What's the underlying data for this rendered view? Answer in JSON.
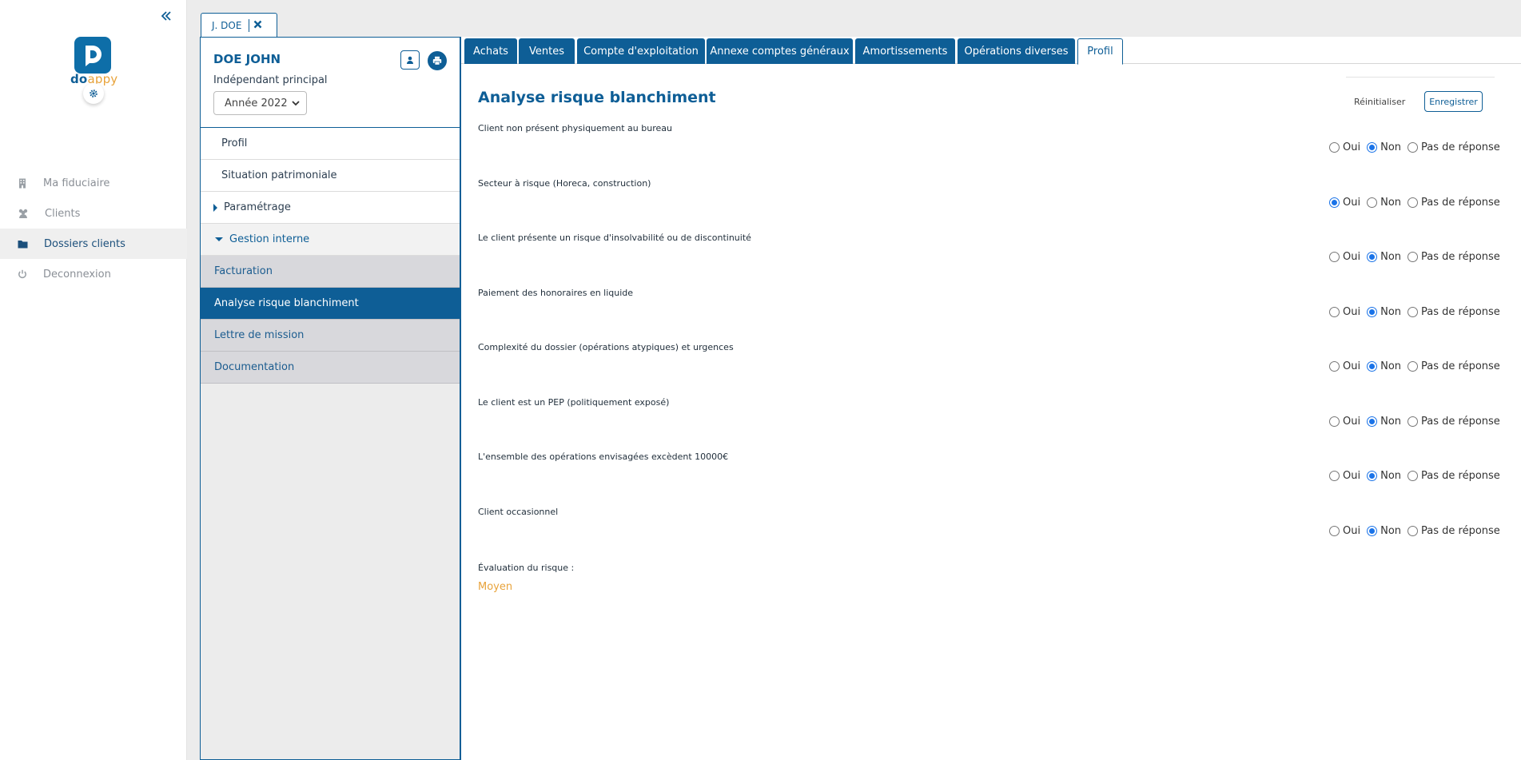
{
  "brand": {
    "name_part1": "do",
    "name_part2": "appy"
  },
  "nav": [
    {
      "label": "Ma fiduciaire",
      "icon": "building-icon",
      "active": false
    },
    {
      "label": "Clients",
      "icon": "users-icon",
      "active": false
    },
    {
      "label": "Dossiers clients",
      "icon": "folder-icon",
      "active": true
    },
    {
      "label": "Deconnexion",
      "icon": "power-icon",
      "active": false
    }
  ],
  "client_tab": {
    "label": "J. DOE"
  },
  "dossier": {
    "name": "DOE JOHN",
    "subtitle": "Indépendant principal",
    "year": "Année 2022"
  },
  "menu": {
    "profil": "Profil",
    "situation": "Situation patrimoniale",
    "parametrage": "Paramétrage",
    "gestion": "Gestion interne",
    "children": [
      "Facturation",
      "Analyse risque blanchiment",
      "Lettre de mission",
      "Documentation"
    ]
  },
  "tabs": [
    "Achats",
    "Ventes",
    "Compte d'exploitation",
    "Annexe comptes généraux",
    "Amortissements",
    "Opérations diverses",
    "Profil"
  ],
  "page": {
    "title": "Analyse risque blanchiment",
    "reset_label": "Réinitialiser",
    "save_label": "Enregistrer"
  },
  "options": {
    "yes": "Oui",
    "no": "Non",
    "none": "Pas de réponse"
  },
  "questions": [
    {
      "label": "Client non présent physiquement au bureau",
      "answer": "Non"
    },
    {
      "label": "Secteur à risque (Horeca, construction)",
      "answer": "Oui"
    },
    {
      "label": "Le client présente un risque d'insolvabilité ou de discontinuité",
      "answer": "Non"
    },
    {
      "label": "Paiement des honoraires en liquide",
      "answer": "Non"
    },
    {
      "label": "Complexité du dossier (opérations atypiques) et urgences",
      "answer": "Non"
    },
    {
      "label": "Le client est un PEP (politiquement exposé)",
      "answer": "Non"
    },
    {
      "label": "L'ensemble des opérations envisagées excèdent 10000€",
      "answer": "Non"
    },
    {
      "label": "Client occasionnel",
      "answer": "Non"
    }
  ],
  "evaluation": {
    "label": "Évaluation du risque :",
    "value": "Moyen"
  },
  "colors": {
    "primary": "#0e5e96",
    "accent": "#e8a33b"
  }
}
